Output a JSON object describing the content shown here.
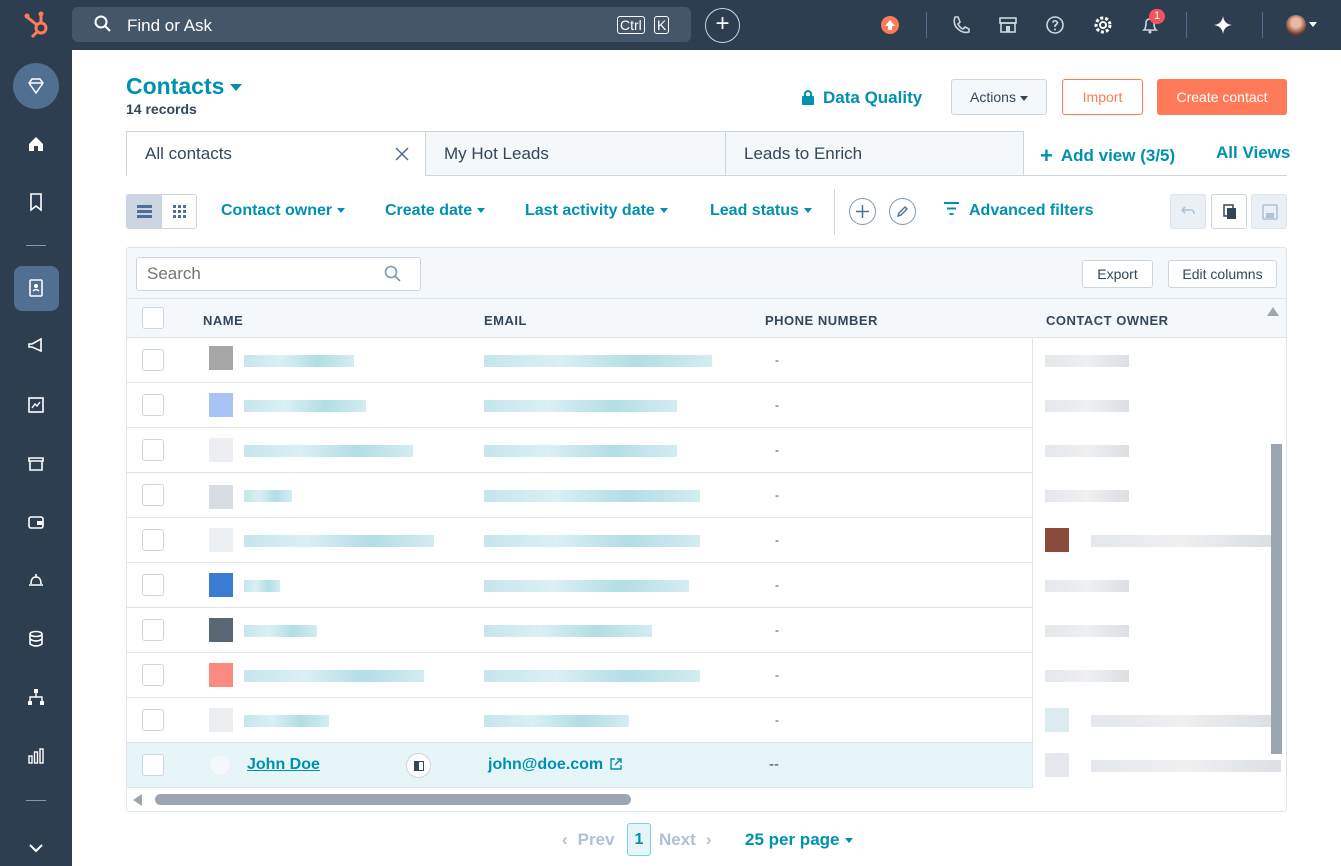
{
  "topbar": {
    "search_placeholder": "Find or Ask",
    "kbd_ctrl": "Ctrl",
    "kbd_k": "K",
    "notification_count": "1"
  },
  "header": {
    "title": "Contacts",
    "records": "14 records",
    "data_quality": "Data Quality",
    "actions": "Actions",
    "import": "Import",
    "create": "Create contact"
  },
  "tabs": [
    {
      "label": "All contacts"
    },
    {
      "label": "My Hot Leads"
    },
    {
      "label": "Leads to Enrich"
    }
  ],
  "add_view": "Add view (3/5)",
  "all_views": "All Views",
  "filters": [
    "Contact owner",
    "Create date",
    "Last activity date",
    "Lead status"
  ],
  "advanced_filters": "Advanced filters",
  "table": {
    "search_placeholder": "Search",
    "export": "Export",
    "edit_columns": "Edit columns",
    "columns": [
      "NAME",
      "EMAIL",
      "PHONE NUMBER",
      "CONTACT OWNER"
    ],
    "highlighted_row": {
      "name": "John Doe",
      "email": "john@doe.com",
      "phone": "--"
    }
  },
  "pagination": {
    "prev": "Prev",
    "page": "1",
    "next": "Next",
    "per_page": "25 per page"
  },
  "colors": {
    "accent": "#0091ae",
    "brand": "#ff7a59",
    "nav": "#2d3e50"
  }
}
